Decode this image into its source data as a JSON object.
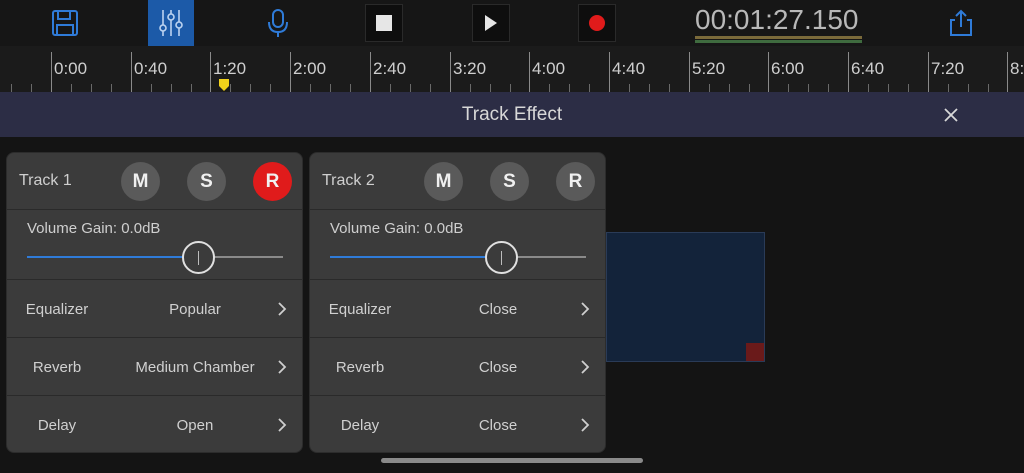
{
  "toolbar": {
    "time": "00:01:27.150",
    "icons": {
      "save": "floppy-disk-icon",
      "mixer": "sliders-icon",
      "mic": "microphone-icon",
      "stop": "stop-icon",
      "play": "play-icon",
      "record": "record-icon",
      "export": "share-export-icon"
    },
    "colors": {
      "accent": "#1c5aa8",
      "record": "#e01b1b"
    }
  },
  "ruler": {
    "labels": [
      "0:00",
      "0:40",
      "1:20",
      "2:00",
      "2:40",
      "3:20",
      "4:00",
      "4:40",
      "5:20",
      "6:00",
      "6:40",
      "7:20",
      "8:"
    ]
  },
  "effect_bar": {
    "title": "Track Effect",
    "close_icon": "close-icon"
  },
  "tracks": [
    {
      "title": "Track 1",
      "buttons": {
        "mute": "M",
        "solo": "S",
        "record": "R"
      },
      "record_active": true,
      "volume_label": "Volume Gain: 0.0dB",
      "volume_level": 0.67,
      "rows": [
        {
          "label": "Equalizer",
          "value": "Popular"
        },
        {
          "label": "Reverb",
          "value": "Medium Chamber"
        },
        {
          "label": "Delay",
          "value": "Open"
        }
      ]
    },
    {
      "title": "Track 2",
      "buttons": {
        "mute": "M",
        "solo": "S",
        "record": "R"
      },
      "record_active": false,
      "volume_label": "Volume Gain: 0.0dB",
      "volume_level": 0.67,
      "rows": [
        {
          "label": "Equalizer",
          "value": "Close"
        },
        {
          "label": "Reverb",
          "value": "Close"
        },
        {
          "label": "Delay",
          "value": "Close"
        }
      ]
    }
  ]
}
